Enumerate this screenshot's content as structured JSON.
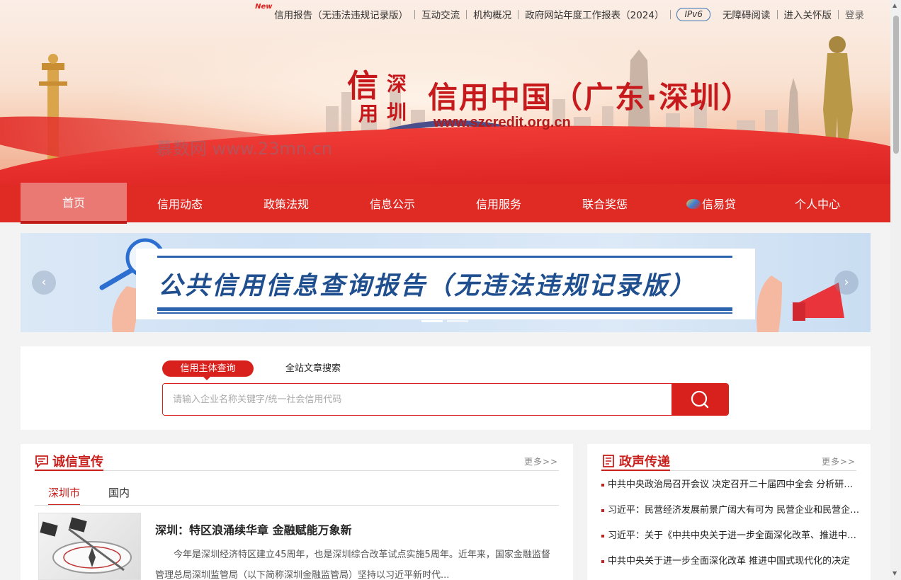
{
  "topbar": {
    "new_badge": "New",
    "links": [
      "信用报告（无违法违规记录版）",
      "互动交流",
      "机构概况",
      "政府网站年度工作报表（2024）"
    ],
    "ipv6": "IPv6",
    "accessibility": "无障碍阅读",
    "elder_mode": "进入关怀版",
    "login": "登录"
  },
  "header": {
    "seal_chars": [
      "信",
      "深",
      "用",
      "圳"
    ],
    "title": "信用中国（广东·深圳）",
    "url": "www.szcredit.org.cn",
    "watermark": "慕数网 www.23mn.cn"
  },
  "nav": {
    "items": [
      "首页",
      "信用动态",
      "政策法规",
      "信息公示",
      "信用服务",
      "联合奖惩",
      "信易贷",
      "个人中心"
    ],
    "active": "首页"
  },
  "banner": {
    "title": "公共信用信息查询报告（无违法违规记录版）",
    "prev": "‹",
    "next": "›"
  },
  "search": {
    "tab_active": "信用主体查询",
    "tab_other": "全站文章搜索",
    "placeholder": "请输入企业名称关键字/统一社会信用代码",
    "button_icon": "search-icon"
  },
  "integrity": {
    "title": "诚信宣传",
    "more": "更多>>",
    "tabs": [
      "深圳市",
      "国内"
    ],
    "article_title": "深圳：特区浪涌续华章 金融赋能万象新",
    "article_summary": "今年是深圳经济特区建立45周年，也是深圳综合改革试点实施5周年。近年来，国家金融监督管理总局深圳监管局（以下简称深圳金融监管局）坚持以习近平新时代..."
  },
  "policy": {
    "title": "政声传递",
    "more": "更多>>",
    "items": [
      "中共中央政治局召开会议 决定召开二十届四中全会 分析研究当前经济形势",
      "习近平：民营经济发展前景广阔大有可为 民营企业和民营企业家大显身手",
      "习近平：关于《中共中央关于进一步全面深化改革、推进中国式现代化的决定》的说明",
      "中共中央关于进一步全面深化改革 推进中国式现代化的决定"
    ]
  },
  "colors": {
    "brand_red": "#e02b25",
    "title_red": "#c61a1d",
    "banner_blue": "#204f8f"
  }
}
